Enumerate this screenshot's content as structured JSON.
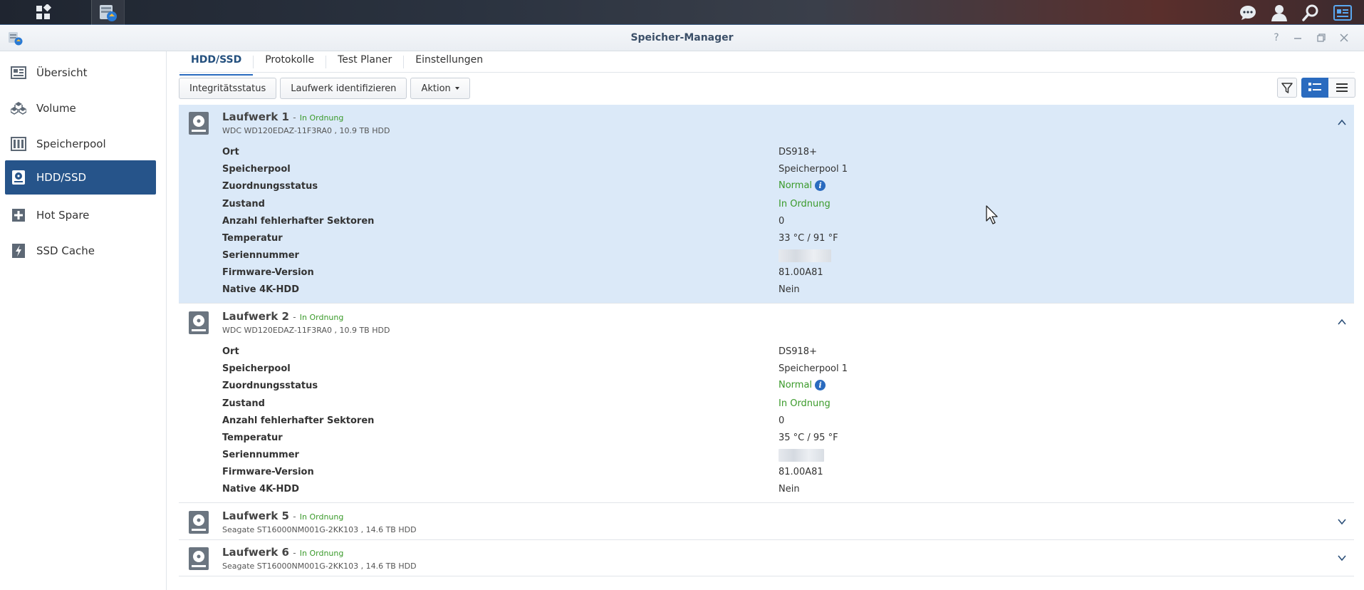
{
  "window": {
    "title": "Speicher-Manager"
  },
  "sidebar": {
    "items": [
      {
        "label": "Übersicht",
        "icon": "overview-icon"
      },
      {
        "label": "Volume",
        "icon": "volume-icon"
      },
      {
        "label": "Speicherpool",
        "icon": "storage-pool-icon"
      },
      {
        "label": "HDD/SSD",
        "icon": "disk-icon",
        "active": true
      },
      {
        "label": "Hot Spare",
        "icon": "hot-spare-icon"
      },
      {
        "label": "SSD Cache",
        "icon": "ssd-cache-icon"
      }
    ]
  },
  "tabs": [
    {
      "label": "HDD/SSD",
      "active": true
    },
    {
      "label": "Protokolle"
    },
    {
      "label": "Test Planer"
    },
    {
      "label": "Einstellungen"
    }
  ],
  "toolbar": {
    "integrity_label": "Integritätsstatus",
    "identify_label": "Laufwerk identifizieren",
    "action_label": "Aktion"
  },
  "drives": [
    {
      "name": "Laufwerk 1",
      "status": "In Ordnung",
      "model": "WDC WD120EDAZ-11F3RA0 , 10.9 TB HDD",
      "expanded": true,
      "selected": true,
      "details": [
        {
          "label": "Ort",
          "value": "DS918+"
        },
        {
          "label": "Speicherpool",
          "value": "Speicherpool 1"
        },
        {
          "label": "Zuordnungsstatus",
          "value": "Normal"
        },
        {
          "label": "Zustand",
          "value": "In Ordnung"
        },
        {
          "label": "Anzahl fehlerhafter Sektoren",
          "value": "0"
        },
        {
          "label": "Temperatur",
          "value": "33 °C / 91 °F"
        },
        {
          "label": "Seriennummer",
          "value": ""
        },
        {
          "label": "Firmware-Version",
          "value": "81.00A81"
        },
        {
          "label": "Native 4K-HDD",
          "value": "Nein"
        }
      ]
    },
    {
      "name": "Laufwerk 2",
      "status": "In Ordnung",
      "model": "WDC WD120EDAZ-11F3RA0 , 10.9 TB HDD",
      "expanded": true,
      "selected": false,
      "details": [
        {
          "label": "Ort",
          "value": "DS918+"
        },
        {
          "label": "Speicherpool",
          "value": "Speicherpool 1"
        },
        {
          "label": "Zuordnungsstatus",
          "value": "Normal"
        },
        {
          "label": "Zustand",
          "value": "In Ordnung"
        },
        {
          "label": "Anzahl fehlerhafter Sektoren",
          "value": "0"
        },
        {
          "label": "Temperatur",
          "value": "35 °C / 95 °F"
        },
        {
          "label": "Seriennummer",
          "value": ""
        },
        {
          "label": "Firmware-Version",
          "value": "81.00A81"
        },
        {
          "label": "Native 4K-HDD",
          "value": "Nein"
        }
      ]
    },
    {
      "name": "Laufwerk 5",
      "status": "In Ordnung",
      "model": "Seagate ST16000NM001G-2KK103 , 14.6 TB HDD",
      "expanded": false
    },
    {
      "name": "Laufwerk 6",
      "status": "In Ordnung",
      "model": "Seagate ST16000NM001G-2KK103 , 14.6 TB HDD",
      "expanded": false
    }
  ],
  "colors": {
    "accent": "#2a6bbf",
    "sidebar_active": "#26548a",
    "status_ok": "#3a9a2a",
    "selected_row": "#dbe9f8"
  }
}
